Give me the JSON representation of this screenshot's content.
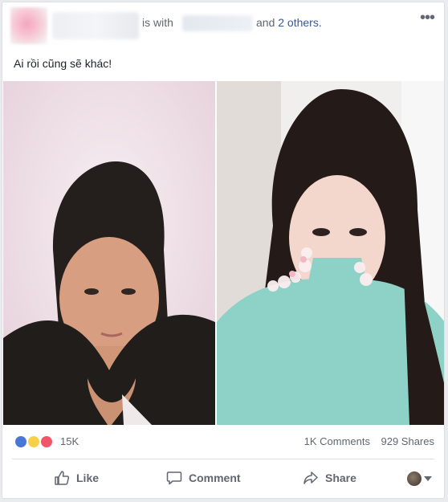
{
  "post": {
    "header": {
      "is_with": "is with",
      "and_text": "and",
      "others": "2 others."
    },
    "text": "Ai rồi cũng sẽ khác!",
    "options_icon": "more-dots-icon"
  },
  "reactions": {
    "icons": [
      "like-reaction-icon",
      "haha-reaction-icon",
      "love-reaction-icon"
    ],
    "count": "15K",
    "comments": "1K Comments",
    "shares": "929 Shares"
  },
  "actions": {
    "like": "Like",
    "comment": "Comment",
    "share": "Share"
  },
  "colors": {
    "link": "#365899",
    "muted": "#606770",
    "background": "#e9ebee"
  }
}
